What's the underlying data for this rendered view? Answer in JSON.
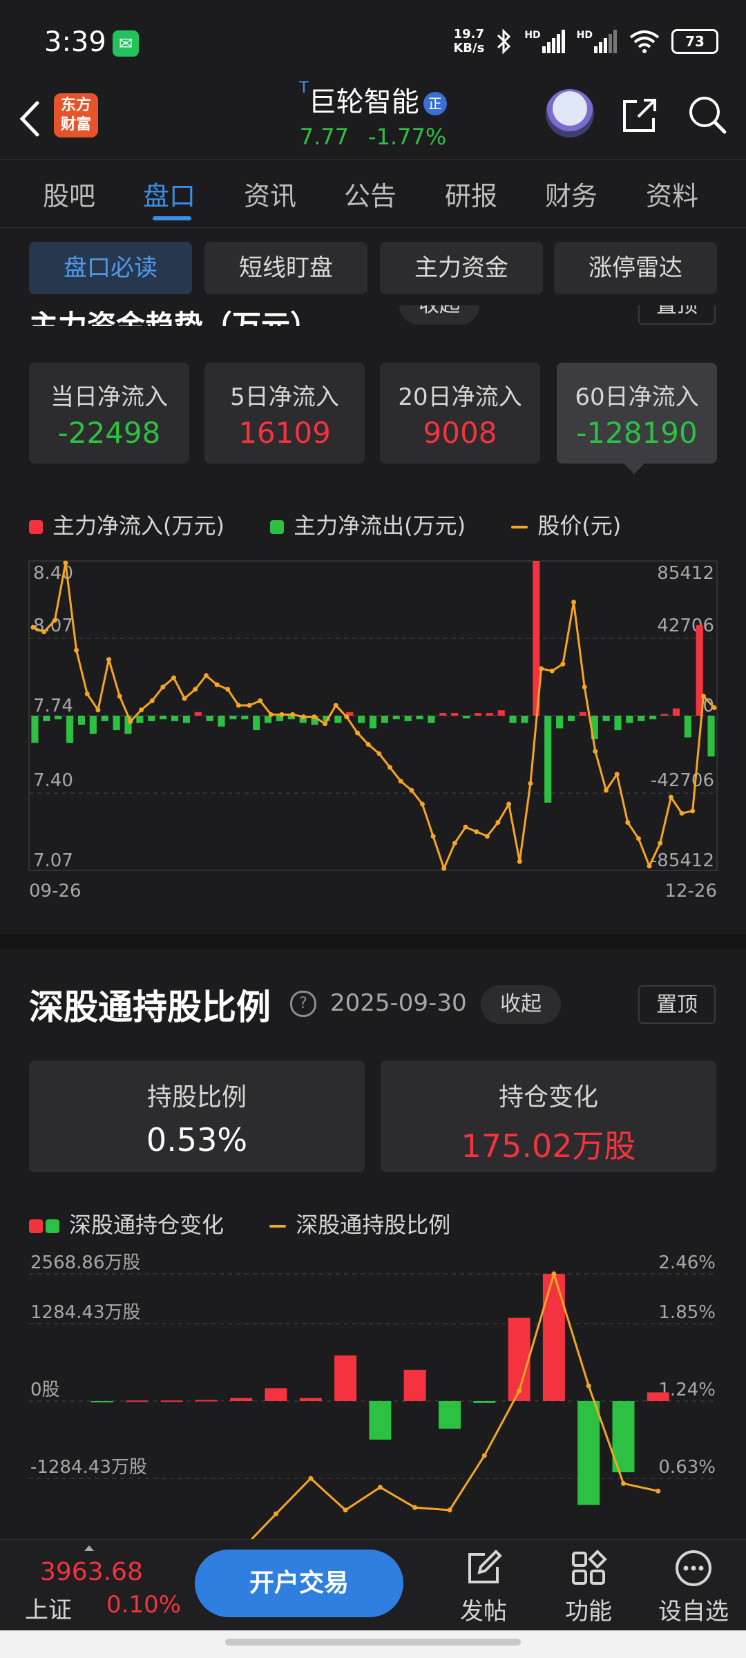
{
  "status_bar": {
    "time": "3:39",
    "net_speed_value": "19.7",
    "net_speed_unit": "KB/s",
    "sim1": "HD",
    "sim2": "HD",
    "battery": "73"
  },
  "header": {
    "logo_line1": "东方",
    "logo_line2": "财富",
    "t_mark": "T",
    "stock_name": "巨轮智能",
    "badge": "正",
    "price": "7.77",
    "change_pct": "-1.77%"
  },
  "tabs": [
    "股吧",
    "盘口",
    "资讯",
    "公告",
    "研报",
    "财务",
    "资料"
  ],
  "active_tab": 1,
  "sub_tabs": [
    "盘口必读",
    "短线盯盘",
    "主力资金",
    "涨停雷达"
  ],
  "partial_section_title": "主力资金趋势（万元）",
  "partial_buttons": [
    "收起",
    "置顶"
  ],
  "flow_cards": [
    {
      "label": "当日净流入",
      "value": "-22498",
      "color": "green"
    },
    {
      "label": "5日净流入",
      "value": "16109",
      "color": "red"
    },
    {
      "label": "20日净流入",
      "value": "9008",
      "color": "red"
    },
    {
      "label": "60日净流入",
      "value": "-128190",
      "color": "green"
    }
  ],
  "chart1_legend": {
    "inflow": "主力净流入(万元)",
    "outflow": "主力净流出(万元)",
    "price": "股价(元)"
  },
  "colors": {
    "red": "#f5333f",
    "green": "#2cc142",
    "orange": "#f5a623",
    "accent": "#3a8ee6"
  },
  "chart_data": [
    {
      "type": "bar",
      "title": "主力资金趋势（万元）",
      "x_start": "09-26",
      "x_end": "12-26",
      "y_left_ticks": [
        "8.40",
        "8.07",
        "7.74",
        "7.40",
        "7.07"
      ],
      "y_right_ticks": [
        "85412",
        "42706",
        "0",
        "-42706",
        "-85412"
      ],
      "ylim_left": [
        7.07,
        8.4
      ],
      "ylim_right": [
        -85412,
        85412
      ],
      "series": [
        {
          "name": "主力净流入(万元) / 主力净流出(万元)",
          "values": [
            -15000,
            -3000,
            -2000,
            -15000,
            -5000,
            -10000,
            -3000,
            -8000,
            -10000,
            -4000,
            -3000,
            -2000,
            -3000,
            -4000,
            2000,
            -3000,
            -6000,
            -2000,
            -2000,
            -8000,
            -4000,
            -3000,
            -2000,
            -4000,
            -5000,
            -3000,
            -4000,
            2000,
            -4000,
            -7000,
            -4000,
            -2000,
            -3000,
            -2000,
            -4000,
            1500,
            1500,
            -1500,
            1500,
            1500,
            3000,
            -4000,
            -4000,
            85412,
            -48000,
            -7000,
            -3000,
            2000,
            -13000,
            -3000,
            -8000,
            -4000,
            -3000,
            -2000,
            1000,
            4000,
            -12000,
            50000,
            -22498
          ]
        },
        {
          "name": "股价(元)",
          "values": [
            8.12,
            8.1,
            8.15,
            8.4,
            8.02,
            7.83,
            7.76,
            7.98,
            7.82,
            7.71,
            7.76,
            7.8,
            7.86,
            7.9,
            7.81,
            7.85,
            7.91,
            7.87,
            7.85,
            7.78,
            7.78,
            7.8,
            7.74,
            7.74,
            7.74,
            7.73,
            7.73,
            7.7,
            7.78,
            7.73,
            7.66,
            7.61,
            7.57,
            7.51,
            7.45,
            7.41,
            7.35,
            7.21,
            7.07,
            7.18,
            7.25,
            7.23,
            7.21,
            7.27,
            7.35,
            7.1,
            7.44,
            7.94,
            7.93,
            7.96,
            8.23,
            7.86,
            7.58,
            7.41,
            7.48,
            7.27,
            7.2,
            7.08,
            7.18,
            7.38,
            7.31,
            7.32,
            7.82,
            7.77
          ]
        }
      ]
    },
    {
      "type": "bar",
      "title": "深股通持股比例",
      "y_left_ticks": [
        "2568.86万股",
        "1284.43万股",
        "0股",
        "-1284.43万股"
      ],
      "y_right_ticks": [
        "2.46%",
        "1.85%",
        "1.24%",
        "0.63%"
      ],
      "series": [
        {
          "name": "深股通持仓变化",
          "unit": "万股",
          "values": [
            -20,
            10,
            10,
            20,
            60,
            260,
            60,
            920,
            -780,
            630,
            -560,
            -40,
            1680,
            2568,
            -2100,
            -1440,
            175
          ]
        },
        {
          "name": "深股通持股比例",
          "unit": "%",
          "values": [
            null,
            null,
            null,
            null,
            null,
            0.35,
            0.63,
            0.38,
            0.56,
            0.4,
            0.38,
            0.81,
            1.32,
            2.46,
            1.36,
            0.59,
            0.53
          ]
        }
      ]
    }
  ],
  "hk_section": {
    "title": "深股通持股比例",
    "help": "?",
    "date": "2025-09-30",
    "collapse": "收起",
    "pin": "置顶"
  },
  "hk_cards": [
    {
      "label": "持股比例",
      "value": "0.53%",
      "color": "white"
    },
    {
      "label": "持仓变化",
      "value": "175.02万股",
      "color": "red"
    }
  ],
  "chart2_legend": {
    "change": "深股通持仓变化",
    "ratio": "深股通持股比例"
  },
  "bottom_bar": {
    "index_value": "3963.68",
    "index_name": "上证",
    "index_pct": "0.10%",
    "trade": "开户交易",
    "post": "发帖",
    "features": "功能",
    "watch": "设自选"
  }
}
